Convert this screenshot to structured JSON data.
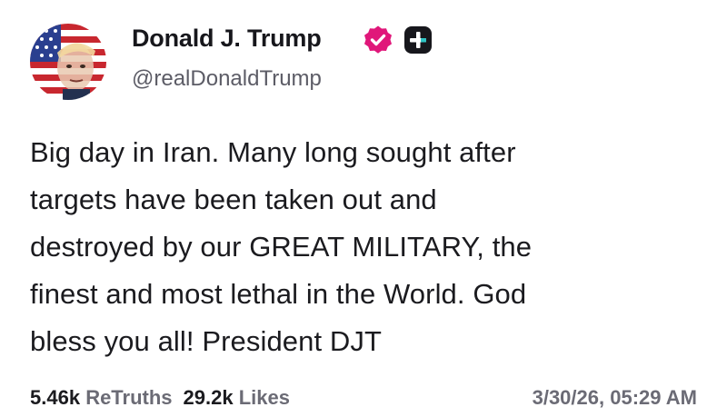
{
  "author": {
    "name": "Donald J. Trump",
    "handle": "@realDonaldTrump",
    "verified": true,
    "avatar_icon": "flag-portrait-avatar",
    "verified_icon": "verified-badge-icon",
    "badge_icon": "plus-badge-icon"
  },
  "post": {
    "text": "Big day in Iran. Many long sought after\ntargets have been taken out and\ndestroyed by our GREAT MILITARY, the\nfinest and most lethal in the World. God\nbless you all! President DJT",
    "timestamp": "3/30/26, 05:29 AM"
  },
  "stats": {
    "retruths_count": "5.46k",
    "retruths_label": "ReTruths",
    "likes_count": "29.2k",
    "likes_label": "Likes"
  },
  "colors": {
    "verified_pink": "#e0177a",
    "badge_dark": "#17171c",
    "text_primary": "#1b1b1f",
    "text_secondary": "#5c5c66"
  }
}
